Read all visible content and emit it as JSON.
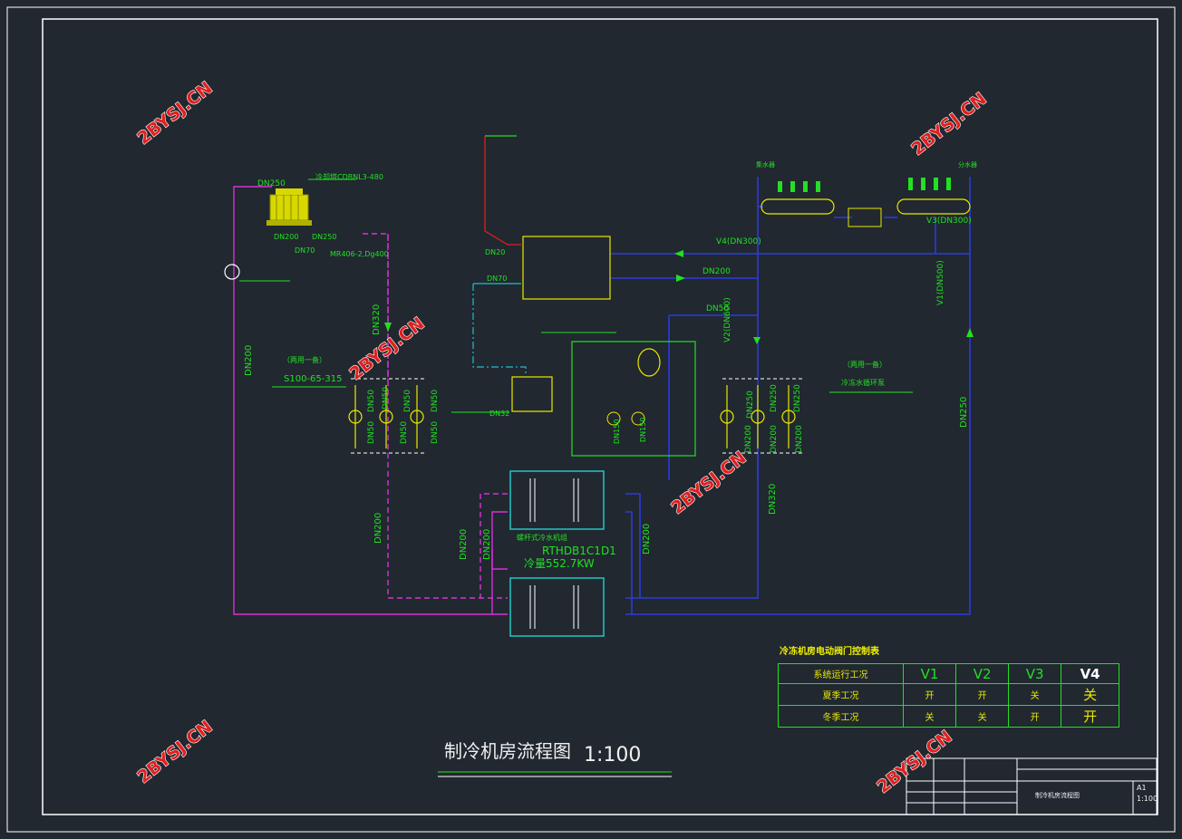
{
  "drawing": {
    "title": "制冷机房流程图",
    "scale": "1:100"
  },
  "watermark": "2BYSJ.CN",
  "cooling_tower": {
    "model": "冷却塔CDBNL3-480",
    "inlet_dn": "DN250",
    "outlet_dn": "DN200",
    "outlet_dn2": "DN250",
    "makeup_dn": "DN70",
    "filter": "MR406-2,Dg400"
  },
  "cooling_pumps": {
    "note": "（两用一备）",
    "model": "S100-65-315",
    "pipe_labels": [
      "DN50",
      "DN50",
      "DN50",
      "DN50"
    ],
    "lower_labels": [
      "DN50",
      "DN50",
      "DN50"
    ]
  },
  "chilled_pumps": {
    "note": "（两用一备）",
    "name": "冷冻水循环泵",
    "pipe_labels": [
      "DN250",
      "DN250",
      "DN250"
    ],
    "lower_labels": [
      "DN200",
      "DN200",
      "DN200"
    ]
  },
  "chiller": {
    "name": "螺杆式冷水机组",
    "model": "RTHDB1C1D1",
    "capacity": "冷量552.7KW"
  },
  "pipes": {
    "dn320_top": "DN320",
    "dn200_left": "DN200",
    "dn200_mid": "DN200",
    "dn200_mid2": "DN200",
    "dn200_left_chiller": "DN200",
    "dn200_right_chiller": "DN200",
    "dn320_right": "DN320",
    "dn250_right": "DN250",
    "v4": "V4(DN300)",
    "dn200_h": "DN200",
    "dn50": "DN50",
    "v2": "V2(DN600)",
    "v1": "V1(DN500)",
    "v3": "V3(DN300)",
    "dn20": "DN20",
    "dn70": "DN70",
    "dn32": "DN32",
    "dn150": "DN150",
    "dn150b": "DN150"
  },
  "headers": {
    "collect": "集水器",
    "distribute": "分水器"
  },
  "control_table": {
    "title": "冷冻机房电动阀门控制表",
    "columns": [
      "系统运行工况",
      "V1",
      "V2",
      "V3",
      "V4"
    ],
    "rows": [
      [
        "夏季工况",
        "开",
        "开",
        "关",
        "关"
      ],
      [
        "冬季工况",
        "关",
        "关",
        "开",
        "开"
      ]
    ]
  },
  "title_block": {
    "sheet": "A1",
    "scale": "1:100",
    "drawing_name": "制冷机房流程图"
  }
}
